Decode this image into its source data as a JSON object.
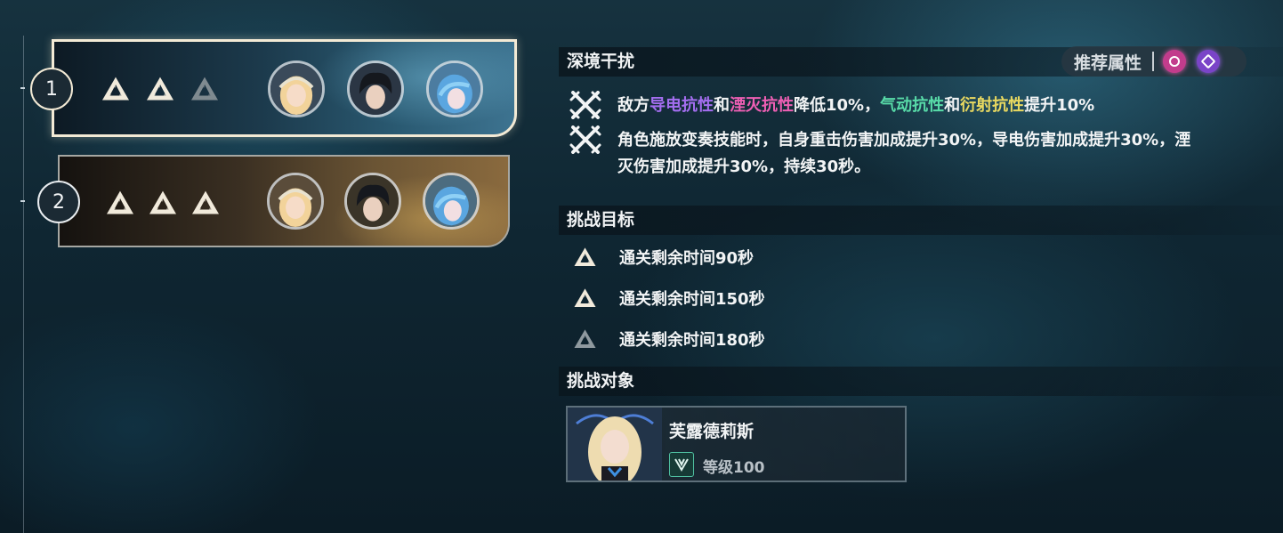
{
  "stages": [
    {
      "number": "1",
      "stars_filled": 2,
      "selected": true
    },
    {
      "number": "2",
      "stars_filled": 3,
      "selected": false
    }
  ],
  "interference": {
    "title": "深境干扰",
    "recommended_label": "推荐属性",
    "recommended_elements": [
      "pink-element-icon",
      "purple-element-icon"
    ],
    "effects": [
      {
        "icon": "crossed-swords-icon",
        "segments": [
          {
            "text": "敌方",
            "color": "default"
          },
          {
            "text": "导电抗性",
            "color": "purple"
          },
          {
            "text": "和",
            "color": "default"
          },
          {
            "text": "湮灭抗性",
            "color": "pink"
          },
          {
            "text": "降低10%，",
            "color": "default"
          },
          {
            "text": "气动抗性",
            "color": "green"
          },
          {
            "text": "和",
            "color": "default"
          },
          {
            "text": "衍射抗性",
            "color": "yellow"
          },
          {
            "text": "提升10%",
            "color": "default"
          }
        ]
      },
      {
        "icon": "crossed-swords-icon",
        "segments": [
          {
            "text": "角色施放变奏技能时，自身重击伤害加成提升30%，导电伤害加成提升30%，湮灭伤害加成提升30%，持续30秒。",
            "color": "default"
          }
        ]
      }
    ]
  },
  "goals": {
    "title": "挑战目标",
    "items": [
      {
        "text": "通关剩余时间90秒",
        "achieved": true
      },
      {
        "text": "通关剩余时间150秒",
        "achieved": true
      },
      {
        "text": "通关剩余时间180秒",
        "achieved": false
      }
    ]
  },
  "target": {
    "title": "挑战对象",
    "name": "芙露德莉斯",
    "level": "等级100"
  },
  "colors": {
    "purple": "#a46ef0",
    "pink": "#ee5fb4",
    "green": "#58dba8",
    "yellow": "#e8d860"
  }
}
